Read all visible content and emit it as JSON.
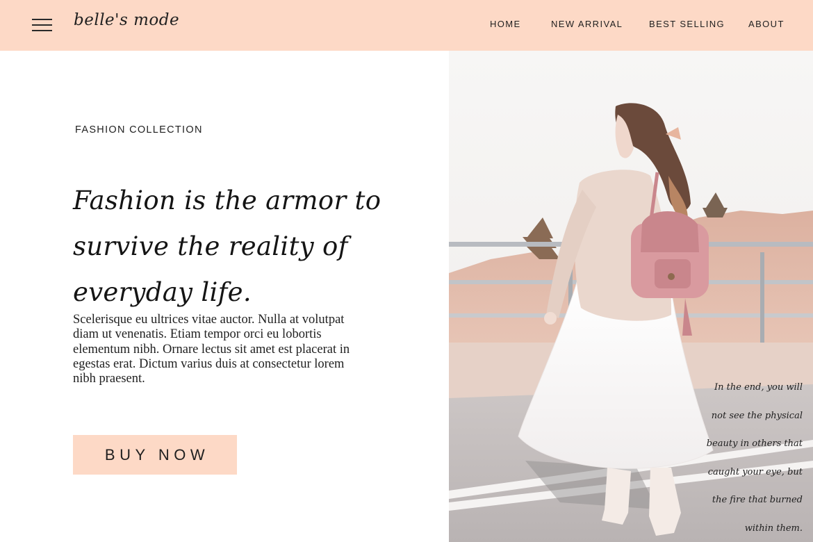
{
  "brand": {
    "logo_text": "belle's mode"
  },
  "icons": {
    "menu": "hamburger-menu-icon"
  },
  "nav": {
    "home": "HOME",
    "new_arrival": "NEW ARRIVAL",
    "best_selling": "BEST SELLING",
    "about": "ABOUT"
  },
  "hero": {
    "eyebrow": "FASHION COLLECTION",
    "headline": "Fashion is the armor to survive the reality of everyday life.",
    "body": "Scelerisque eu ultrices vitae auctor. Nulla at volutpat diam ut venenatis. Etiam tempor orci eu lobortis elementum nibh. Ornare lectus sit amet est placerat in egestas erat. Dictum varius duis at consectetur lorem nibh praesent.",
    "cta_label": "BUY NOW",
    "quote": "In the end, you will not see the physical beauty in others that caught your eye, but the fire that burned within them."
  },
  "colors": {
    "accent": "#fdd9c6",
    "text": "#1f1f1f",
    "background": "#ffffff"
  }
}
